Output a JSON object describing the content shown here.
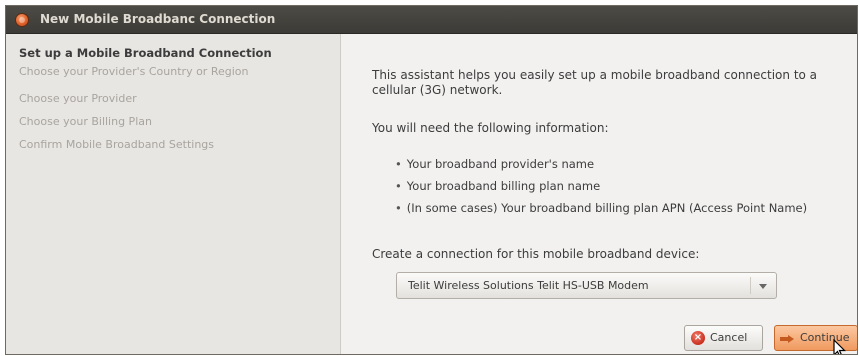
{
  "window": {
    "title": "New Mobile Broadbanc Connection"
  },
  "sidebar": {
    "steps": [
      {
        "label": "Set up a Mobile Broadband Connection",
        "current": true
      },
      {
        "label": "Choose your Provider's Country or Region",
        "current": false
      },
      {
        "label": "Choose your Provider",
        "current": false
      },
      {
        "label": "Choose your Billing Plan",
        "current": false
      },
      {
        "label": "Confirm Mobile Broadband Settings",
        "current": false
      }
    ]
  },
  "main": {
    "intro": "This assistant helps you easily set up a mobile broadband connection to a cellular (3G) network.",
    "need_info": "You will need the following information:",
    "requirements": [
      "Your broadband provider's name",
      "Your broadband billing plan name",
      "(In some cases) Your broadband billing plan APN (Access Point Name)"
    ],
    "device_label": "Create a connection for this mobile broadband device:",
    "device_selected": "Telit Wireless Solutions Telit HS-USB Modem"
  },
  "buttons": {
    "cancel_label": "Cancel",
    "continue_label": "Continue"
  },
  "icons": {
    "close": "close-icon",
    "cancel": "cancel-icon",
    "continue": "forward-arrow-icon",
    "dropdown": "chevron-down-icon",
    "cursor": "mouse-cursor-icon"
  },
  "colors": {
    "titlebar": "#3d3b37",
    "title_text": "#dfdbd2",
    "sidebar_bg": "#e8e6e3",
    "content_bg": "#f2f1f0",
    "accent": "#f09a5f"
  }
}
